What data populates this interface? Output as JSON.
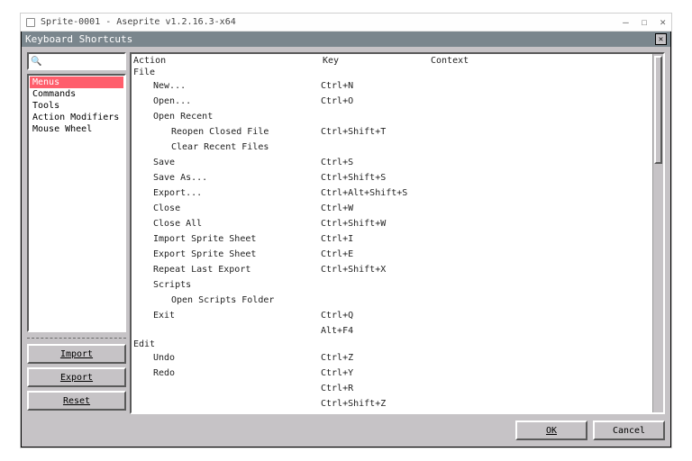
{
  "window": {
    "title": "Sprite-0001 - Aseprite v1.2.16.3-x64",
    "controls": {
      "min": "—",
      "max": "☐",
      "close": "✕"
    }
  },
  "dialog": {
    "title": "Keyboard Shortcuts",
    "close_glyph": "✕",
    "search_placeholder": "",
    "categories": [
      "Menus",
      "Commands",
      "Tools",
      "Action Modifiers",
      "Mouse Wheel"
    ],
    "selected_category": "Menus",
    "side_buttons": {
      "import": "Import",
      "export": "Export",
      "reset": "Reset"
    },
    "columns": {
      "action": "Action",
      "key": "Key",
      "context": "Context"
    },
    "footer": {
      "ok": "OK",
      "cancel": "Cancel"
    },
    "groups": [
      {
        "label": "File",
        "rows": [
          {
            "action": "New...",
            "key": "Ctrl+N"
          },
          {
            "action": "Open...",
            "key": "Ctrl+O"
          },
          {
            "action": "Open Recent",
            "key": "",
            "isGroup": true
          },
          {
            "action": "Reopen Closed File",
            "key": "Ctrl+Shift+T",
            "sub": true
          },
          {
            "action": "Clear Recent Files",
            "key": "",
            "sub": true
          },
          {
            "action": "Save",
            "key": "Ctrl+S"
          },
          {
            "action": "Save As...",
            "key": "Ctrl+Shift+S"
          },
          {
            "action": "Export...",
            "key": "Ctrl+Alt+Shift+S"
          },
          {
            "action": "Close",
            "key": "Ctrl+W"
          },
          {
            "action": "Close All",
            "key": "Ctrl+Shift+W"
          },
          {
            "action": "Import Sprite Sheet",
            "key": "Ctrl+I"
          },
          {
            "action": "Export Sprite Sheet",
            "key": "Ctrl+E"
          },
          {
            "action": "Repeat Last Export",
            "key": "Ctrl+Shift+X"
          },
          {
            "action": "Scripts",
            "key": "",
            "isGroup": true
          },
          {
            "action": "Open Scripts Folder",
            "key": "",
            "sub": true
          },
          {
            "action": "Exit",
            "key": "Ctrl+Q"
          },
          {
            "action": "",
            "key": "Alt+F4"
          }
        ]
      },
      {
        "label": "Edit",
        "rows": [
          {
            "action": "Undo",
            "key": "Ctrl+Z"
          },
          {
            "action": "Redo",
            "key": "Ctrl+Y"
          },
          {
            "action": "",
            "key": "Ctrl+R"
          },
          {
            "action": "",
            "key": "Ctrl+Shift+Z"
          }
        ]
      }
    ]
  }
}
